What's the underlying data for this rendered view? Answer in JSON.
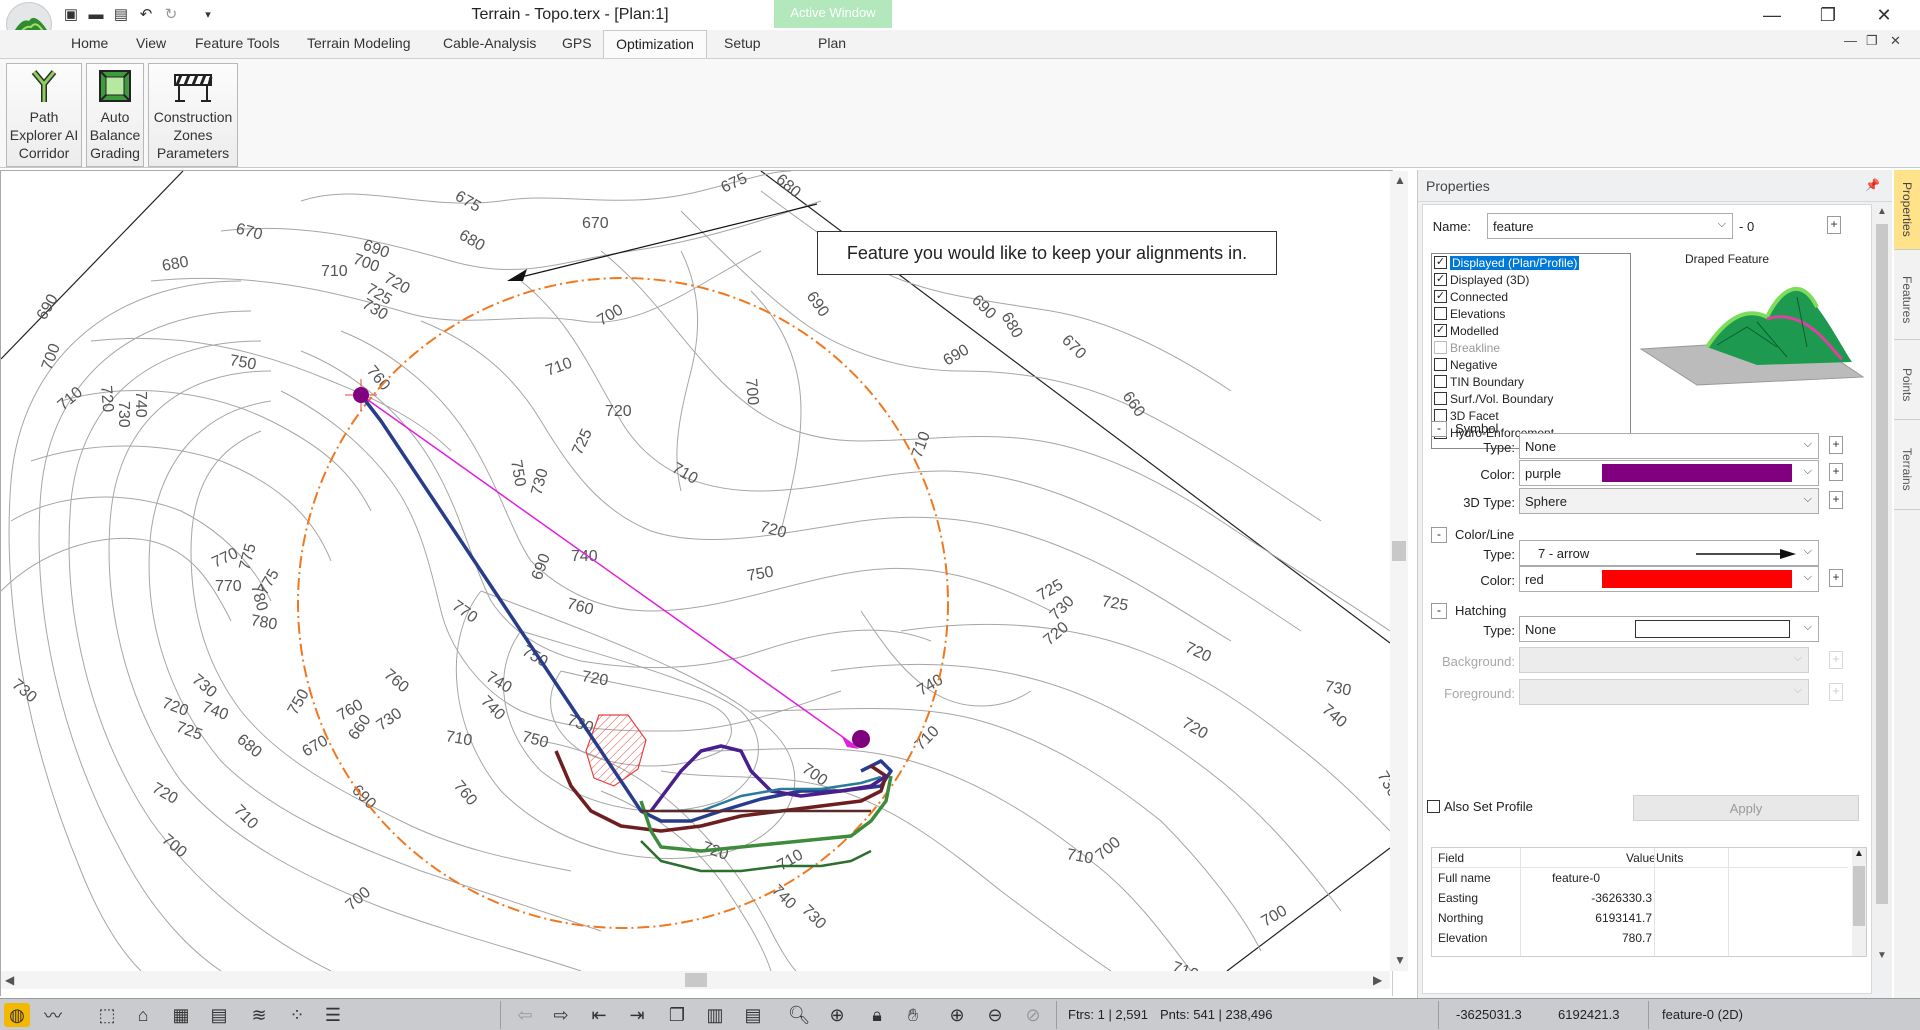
{
  "window": {
    "title": "Terrain - Topo.terx - [Plan:1]",
    "active_window_label": "Active Window",
    "minimize": "—",
    "maximize": "❐",
    "close": "✕"
  },
  "quick_access": {
    "icons": [
      "new-file-icon",
      "open-folder-icon",
      "save-icon",
      "undo-icon",
      "redo-icon",
      "customize-dropdown-icon"
    ]
  },
  "ribbon_tabs": [
    "Home",
    "View",
    "Feature Tools",
    "Terrain Modeling",
    "Cable-Analysis",
    "GPS",
    "Optimization",
    "Setup",
    "Plan"
  ],
  "active_tab": "Optimization",
  "mdi_controls": [
    "—",
    "❐",
    "✕"
  ],
  "ribbon_buttons": [
    {
      "lines": [
        "Path",
        "Explorer AI",
        "Corridor"
      ],
      "icon": "path-explorer-icon"
    },
    {
      "lines": [
        "Auto",
        "Balance",
        "Grading"
      ],
      "icon": "auto-balance-icon"
    },
    {
      "lines": [
        "Construction",
        "Zones",
        "Parameters"
      ],
      "icon": "construction-zones-icon"
    }
  ],
  "map": {
    "callout": "Feature you would like to keep your alignments in.",
    "contour_labels": [
      "675",
      "675",
      "680",
      "670",
      "670",
      "690",
      "680",
      "680",
      "700",
      "710",
      "720",
      "725",
      "730",
      "690",
      "700",
      "690",
      "690",
      "680",
      "670",
      "660",
      "690",
      "700",
      "700",
      "710",
      "720",
      "725",
      "730",
      "710",
      "720",
      "750",
      "740",
      "720",
      "710",
      "730",
      "710",
      "750",
      "760",
      "770",
      "780",
      "775",
      "770",
      "760",
      "750",
      "740",
      "730",
      "720",
      "725",
      "730",
      "740",
      "750",
      "760",
      "770",
      "775",
      "780",
      "760",
      "750",
      "740",
      "730",
      "720",
      "710",
      "700",
      "690",
      "710",
      "720",
      "730",
      "740",
      "750",
      "760",
      "740",
      "730",
      "720",
      "710",
      "700",
      "690",
      "680",
      "670",
      "660",
      "700",
      "710",
      "740",
      "730",
      "725",
      "720",
      "720",
      "725",
      "730",
      "740",
      "730",
      "720",
      "710",
      "700",
      "700",
      "710"
    ]
  },
  "properties": {
    "title": "Properties",
    "name_label": "Name:",
    "name_value": "feature",
    "name_suffix": "- 0",
    "flags": [
      {
        "label": "Displayed (Plan/Profile)",
        "checked": true,
        "selected": true
      },
      {
        "label": "Displayed (3D)",
        "checked": true
      },
      {
        "label": "Connected",
        "checked": true
      },
      {
        "label": "Elevations",
        "checked": false
      },
      {
        "label": "Modelled",
        "checked": true
      },
      {
        "label": "Breakline",
        "checked": false,
        "disabled": true
      },
      {
        "label": "Negative",
        "checked": false
      },
      {
        "label": "TIN Boundary",
        "checked": false
      },
      {
        "label": "Surf./Vol. Boundary",
        "checked": false
      },
      {
        "label": "3D Facet",
        "checked": false
      },
      {
        "label": "Hydro-Enforcement",
        "checked": false
      }
    ],
    "draped_title": "Draped Feature",
    "symbol": {
      "section": "Symbol",
      "type_label": "Type:",
      "type_value": "None",
      "color_label": "Color:",
      "color_value": "purple",
      "color_hex": "#800080",
      "type3d_label": "3D Type:",
      "type3d_value": "Sphere"
    },
    "colorline": {
      "section": "Color/Line",
      "type_label": "Type:",
      "type_value": "7 - arrow",
      "color_label": "Color:",
      "color_value": "red",
      "color_hex": "#ff0000"
    },
    "hatching": {
      "section": "Hatching",
      "type_label": "Type:",
      "type_value": "None",
      "background_label": "Background:",
      "foreground_label": "Foreground:"
    },
    "also_set_profile": "Also Set Profile",
    "apply": "Apply",
    "grid": {
      "headers": [
        "Field",
        "Value",
        "Units"
      ],
      "rows": [
        {
          "field": "Full name",
          "value": "feature-0",
          "units": ""
        },
        {
          "field": "Easting",
          "value": "-3626330.3",
          "units": ""
        },
        {
          "field": "Northing",
          "value": "6193141.7",
          "units": ""
        },
        {
          "field": "Elevation",
          "value": "780.7",
          "units": ""
        }
      ]
    }
  },
  "side_tabs": [
    "Properties",
    "Features",
    "Points",
    "Terrains"
  ],
  "status": {
    "features": "Ftrs: 1 | 2,591",
    "points": "Pnts: 541 | 238,496",
    "easting": "-3625031.3",
    "northing": "6192421.3",
    "selection": "feature-0 (2D)"
  },
  "colors": {
    "corridor": "#f07820",
    "arrow": "#e020e0",
    "hatch": "#e84040",
    "path1": "#283c8c",
    "path2": "#6e1e1e",
    "path3": "#3c8c3c",
    "path4": "#4a1e8c"
  }
}
